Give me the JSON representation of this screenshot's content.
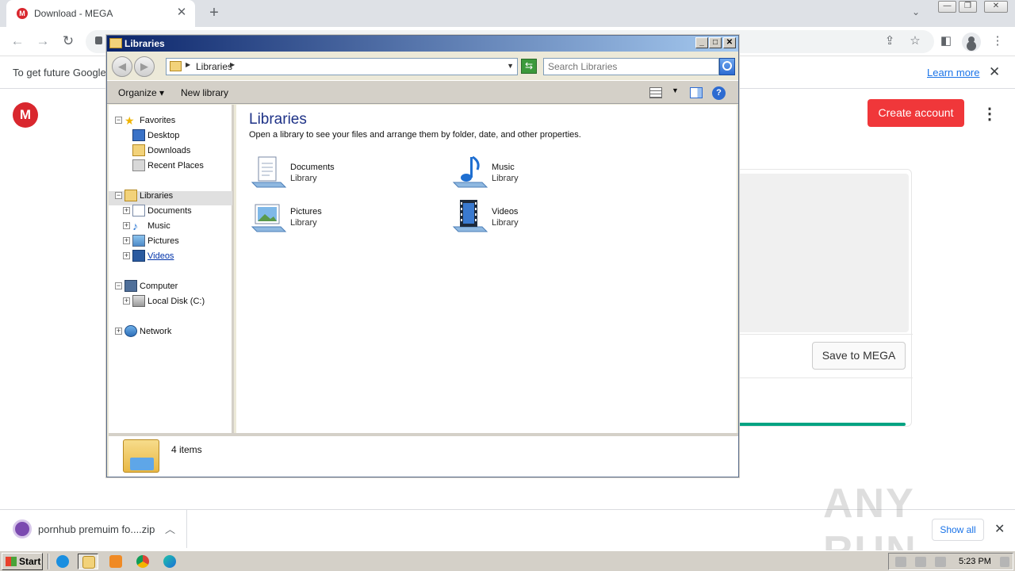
{
  "browser": {
    "tab_title": "Download - MEGA",
    "tab_favicon_letter": "M",
    "newtab_label": "+",
    "infobar_text": "To get future Google",
    "infobar_link": "Learn more"
  },
  "mega": {
    "logo_letter": "M",
    "create_account": "Create account",
    "save_to_mega": "Save to MEGA",
    "brand_color": "#f0373a",
    "progress_color": "#00a382"
  },
  "downloads": {
    "file_name": "pornhub premuim fo....zip",
    "show_all": "Show all"
  },
  "explorer": {
    "title": "Libraries",
    "address": "Libraries",
    "search_placeholder": "Search Libraries",
    "commands": {
      "organize": "Organize",
      "new_library": "New library"
    },
    "nav": {
      "favorites": "Favorites",
      "desktop": "Desktop",
      "downloads": "Downloads",
      "recent_places": "Recent Places",
      "libraries": "Libraries",
      "documents": "Documents",
      "music": "Music",
      "pictures": "Pictures",
      "videos": "Videos",
      "computer": "Computer",
      "local_disk": "Local Disk (C:)",
      "network": "Network"
    },
    "heading": "Libraries",
    "description": "Open a library to see your files and arrange them by folder, date, and other properties.",
    "libraries": [
      {
        "name": "Documents",
        "type": "Library",
        "icon": "documents-library-icon"
      },
      {
        "name": "Music",
        "type": "Library",
        "icon": "music-library-icon"
      },
      {
        "name": "Pictures",
        "type": "Library",
        "icon": "pictures-library-icon"
      },
      {
        "name": "Videos",
        "type": "Library",
        "icon": "videos-library-icon"
      }
    ],
    "status": "4 items"
  },
  "taskbar": {
    "start": "Start",
    "clock": "5:23 PM"
  },
  "watermark": "ANY RUN"
}
